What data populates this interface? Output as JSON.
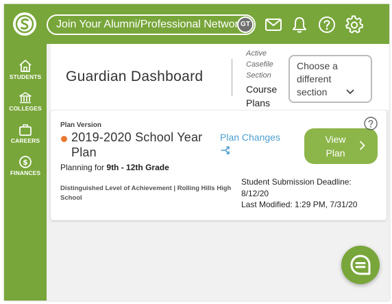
{
  "header": {
    "network_button": "Join Your Alumni/Professional Network",
    "avatar_initials": "GT",
    "icons": [
      "mail-icon",
      "bell-icon",
      "help-icon",
      "settings-icon"
    ]
  },
  "sidebar": {
    "items": [
      {
        "label": "STUDENTS",
        "icon": "home-icon"
      },
      {
        "label": "COLLEGES",
        "icon": "college-icon"
      },
      {
        "label": "CAREERS",
        "icon": "briefcase-icon"
      },
      {
        "label": "FINANCES",
        "icon": "dollar-icon"
      }
    ]
  },
  "page": {
    "title": "Guardian Dashboard",
    "section_label": "Active Casefile Section",
    "section_value": "Course Plans",
    "section_select": "Choose a different section"
  },
  "plan": {
    "version_label": "Plan Version",
    "title": "2019-2020 School Year Plan",
    "planning_prefix": "Planning for ",
    "planning_grades": "9th - 12th Grade",
    "achievement": "Distinguished Level of Achievement | Rolling Hills High School",
    "changes_link": "Plan Changes",
    "view_button": "View Plan",
    "deadline": "Student Submission Deadline: 8/12/20",
    "modified": "Last Modified: 1:29 PM, 7/31/20"
  },
  "colors": {
    "brand_green": "#78a63a",
    "button_green": "#8cb54a",
    "link_blue": "#4e9fd0",
    "status_orange": "#e8772e"
  }
}
